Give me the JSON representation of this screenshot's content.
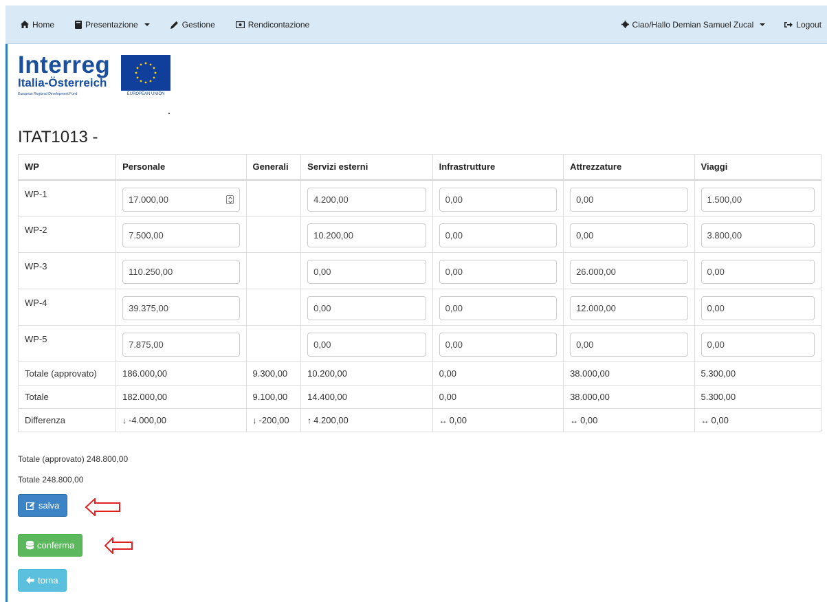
{
  "nav": {
    "home": "Home",
    "presentazione": "Presentazione",
    "gestione": "Gestione",
    "rendicontazione": "Rendicontazione",
    "user": "Ciao/Hallo Demian Samuel Zucal",
    "logout": "Logout"
  },
  "logo": {
    "title": "Interreg",
    "subtitle": "Italia-Österreich",
    "fund": "European Regional Development Fund",
    "eu": "EUROPEAN UNION"
  },
  "page_title": "ITAT1013 -",
  "table": {
    "headers": [
      "WP",
      "Personale",
      "Generali",
      "Servizi esterni",
      "Infrastrutture",
      "Attrezzature",
      "Viaggi"
    ],
    "wp_rows": [
      {
        "label": "WP-1",
        "personale": "17.000,00",
        "servizi": "4.200,00",
        "infra": "0,00",
        "attrez": "0,00",
        "viaggi": "1.500,00"
      },
      {
        "label": "WP-2",
        "personale": "7.500,00",
        "servizi": "10.200,00",
        "infra": "0,00",
        "attrez": "0,00",
        "viaggi": "3.800,00"
      },
      {
        "label": "WP-3",
        "personale": "110.250,00",
        "servizi": "0,00",
        "infra": "0,00",
        "attrez": "26.000,00",
        "viaggi": "0,00"
      },
      {
        "label": "WP-4",
        "personale": "39.375,00",
        "servizi": "0,00",
        "infra": "0,00",
        "attrez": "12.000,00",
        "viaggi": "0,00"
      },
      {
        "label": "WP-5",
        "personale": "7.875,00",
        "servizi": "0,00",
        "infra": "0,00",
        "attrez": "0,00",
        "viaggi": "0,00"
      }
    ],
    "totale_approvato": {
      "label": "Totale (approvato)",
      "values": [
        "186.000,00",
        "9.300,00",
        "10.200,00",
        "0,00",
        "38.000,00",
        "5.300,00"
      ]
    },
    "totale": {
      "label": "Totale",
      "values": [
        "182.000,00",
        "9.100,00",
        "14.400,00",
        "0,00",
        "38.000,00",
        "5.300,00"
      ]
    },
    "differenza": {
      "label": "Differenza",
      "values": [
        "-4.000,00",
        "-200,00",
        "4.200,00",
        "0,00",
        "0,00",
        "0,00"
      ],
      "arrows": [
        "↓",
        "↓",
        "↑",
        "↔",
        "↔",
        "↔"
      ]
    }
  },
  "summary": {
    "approvato": "Totale (approvato) 248.800,00",
    "totale": "Totale 248.800,00"
  },
  "buttons": {
    "salva": "salva",
    "conferma": "conferma",
    "torna": "torna"
  },
  "colors": {
    "navbar_bg": "#d9e9f5",
    "primary": "#3c84c6",
    "success": "#5cb85c",
    "info": "#5bc0de",
    "annotation": "#e02020"
  }
}
